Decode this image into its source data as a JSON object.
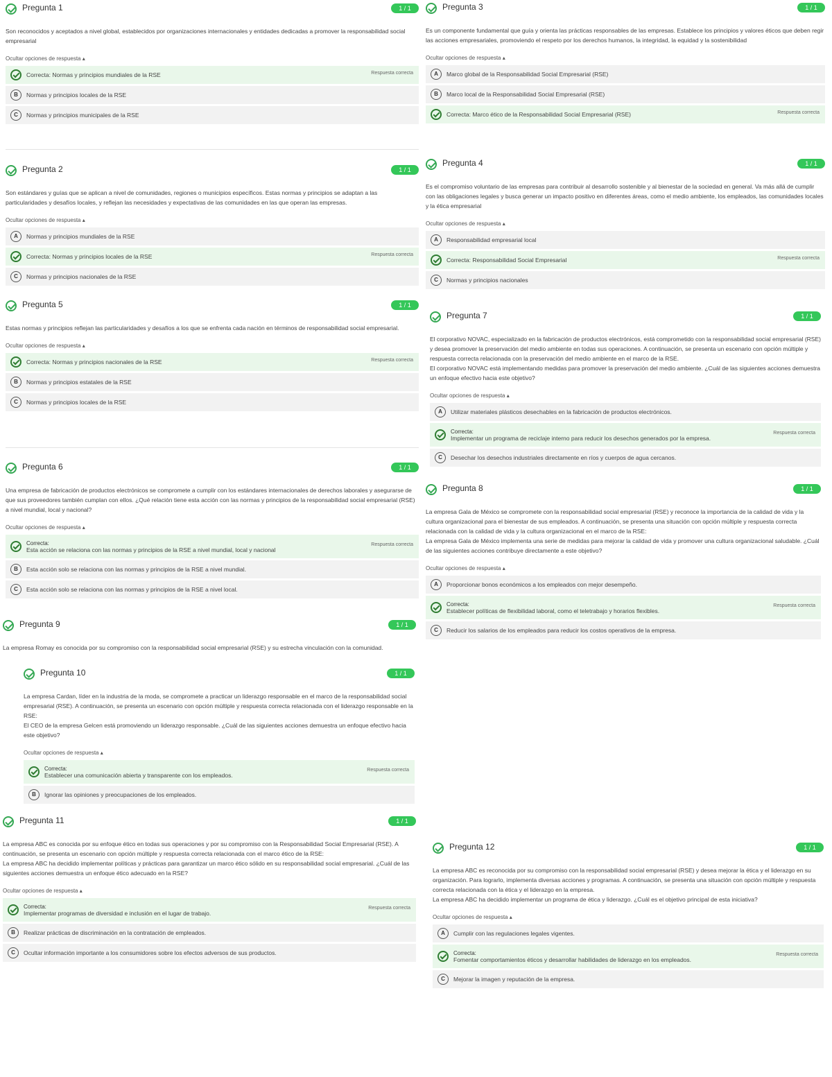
{
  "colors": {
    "accent": "#34c759",
    "correct_bg": "#e9f7ea",
    "option_bg": "#f2f2f2"
  },
  "ui": {
    "hide_options": "Ocultar opciones de respuesta ▴",
    "correct_prefix": "Correcta:",
    "correct_response": "Respuesta correcta",
    "icon_check": "check-circle-icon"
  },
  "questions": {
    "q1": {
      "title": "Pregunta 1",
      "score": "1 / 1",
      "text": "Son reconocidos y aceptados a nivel global, establecidos por organizaciones internacionales y entidades dedicadas a promover la responsabilidad social empresarial",
      "opts": [
        {
          "letter": "A",
          "text": "Correcta: Normas y principios mundiales de la RSE",
          "correct": true
        },
        {
          "letter": "B",
          "text": "Normas y principios locales de la RSE"
        },
        {
          "letter": "C",
          "text": "Normas y principios municipales de la RSE"
        }
      ]
    },
    "q2": {
      "title": "Pregunta 2",
      "score": "1 / 1",
      "text": "Son estándares y guías que se aplican a nivel de comunidades, regiones o municipios específicos. Estas normas y principios se adaptan a las particularidades y desafíos locales, y reflejan las necesidades y expectativas de las comunidades en las que operan las empresas.",
      "opts": [
        {
          "letter": "A",
          "text": "Normas y principios mundiales de la RSE"
        },
        {
          "letter": "B",
          "text": "Correcta: Normas y principios locales de la RSE",
          "correct": true
        },
        {
          "letter": "C",
          "text": "Normas y principios nacionales de la RSE"
        }
      ]
    },
    "q3": {
      "title": "Pregunta 3",
      "score": "1 / 1",
      "text": "Es un componente fundamental que guía y orienta las prácticas responsables de las empresas. Establece los principios y valores éticos que deben regir las acciones empresariales, promoviendo el respeto por los derechos humanos, la integridad, la equidad y la sostenibilidad",
      "opts": [
        {
          "letter": "A",
          "text": "Marco global de la Responsabilidad Social Empresarial (RSE)"
        },
        {
          "letter": "B",
          "text": "Marco local de la Responsabilidad Social Empresarial (RSE)"
        },
        {
          "letter": "C",
          "text": "Correcta: Marco ético de la Responsabilidad Social Empresarial (RSE)",
          "correct": true
        }
      ]
    },
    "q4": {
      "title": "Pregunta 4",
      "score": "1 / 1",
      "text": "Es el compromiso voluntario de las empresas para contribuir al desarrollo sostenible y al bienestar de la sociedad en general. Va más allá de cumplir con las obligaciones legales y busca generar un impacto positivo en diferentes áreas, como el medio ambiente, los empleados, las comunidades locales y la ética empresarial",
      "opts": [
        {
          "letter": "A",
          "text": "Responsabilidad empresarial local"
        },
        {
          "letter": "B",
          "text": "Correcta: Responsabilidad Social Empresarial",
          "correct": true
        },
        {
          "letter": "C",
          "text": "Normas y principios nacionales"
        }
      ]
    },
    "q5": {
      "title": "Pregunta 5",
      "score": "1 / 1",
      "text": "Estas normas y principios reflejan las particularidades y desafíos a los que se enfrenta cada nación en términos de responsabilidad social empresarial.",
      "opts": [
        {
          "letter": "A",
          "text": "Correcta: Normas y principios nacionales de la RSE",
          "correct": true
        },
        {
          "letter": "B",
          "text": "Normas y principios estatales de la RSE"
        },
        {
          "letter": "C",
          "text": "Normas y principios locales de la RSE"
        }
      ]
    },
    "q6": {
      "title": "Pregunta 6",
      "score": "1 / 1",
      "text": "Una empresa de fabricación de productos electrónicos se compromete a cumplir con los estándares internacionales de derechos laborales y asegurarse de que sus proveedores también cumplan con ellos. ¿Qué relación tiene esta acción con las normas y principios de la responsabilidad social empresarial (RSE) a nivel mundial, local y nacional?",
      "opts": [
        {
          "letter": "A",
          "text": "Esta acción se relaciona con las normas y principios de la RSE a nivel mundial, local y nacional",
          "correct": true
        },
        {
          "letter": "B",
          "text": "Esta acción solo se relaciona con las normas y principios de la RSE a nivel mundial."
        },
        {
          "letter": "C",
          "text": "Esta acción solo se relaciona con las normas y principios de la RSE a nivel local."
        }
      ]
    },
    "q7": {
      "title": "Pregunta 7",
      "score": "1 / 1",
      "text": "El corporativo NOVAC, especializado en la fabricación de productos electrónicos, está comprometido con la responsabilidad social empresarial (RSE) y desea promover la preservación del medio ambiente en todas sus operaciones. A continuación, se presenta un escenario con opción múltiple y respuesta correcta relacionada con la preservación del medio ambiente en el marco de la RSE.\nEl corporativo NOVAC está implementando medidas para promover la preservación del medio ambiente. ¿Cuál de las siguientes acciones demuestra un enfoque efectivo hacia este objetivo?",
      "opts": [
        {
          "letter": "A",
          "text": "Utilizar materiales plásticos desechables en la fabricación de productos electrónicos."
        },
        {
          "letter": "B",
          "text": "Implementar un programa de reciclaje interno para reducir los desechos generados por la empresa.",
          "correct": true
        },
        {
          "letter": "C",
          "text": "Desechar los desechos industriales directamente en ríos y cuerpos de agua cercanos."
        }
      ]
    },
    "q8": {
      "title": "Pregunta 8",
      "score": "1 / 1",
      "text": "La empresa Gala de México se compromete con la responsabilidad social empresarial (RSE) y reconoce la importancia de la calidad de vida y la cultura organizacional para el bienestar de sus empleados. A continuación, se presenta una situación con opción múltiple y respuesta correcta relacionada con la calidad de vida y la cultura organizacional en el marco de la RSE:\nLa empresa Gala de México implementa una serie de medidas para mejorar la calidad de vida y promover una cultura organizacional saludable. ¿Cuál de las siguientes acciones contribuye directamente a este objetivo?",
      "opts": [
        {
          "letter": "A",
          "text": "Proporcionar bonos económicos a los empleados con mejor desempeño."
        },
        {
          "letter": "B",
          "text": "Establecer políticas de flexibilidad laboral, como el teletrabajo y horarios flexibles.",
          "correct": true
        },
        {
          "letter": "C",
          "text": "Reducir los salarios de los empleados para reducir los costos operativos de la empresa."
        }
      ]
    },
    "q9": {
      "title": "Pregunta 9",
      "score": "1 / 1",
      "text": "La empresa Romay es conocida por su compromiso con la responsabilidad social empresarial (RSE) y su estrecha vinculación con la comunidad."
    },
    "q10": {
      "title": "Pregunta 10",
      "score": "1 / 1",
      "text": "La empresa Cardan, líder en la industria de la moda, se compromete a practicar un liderazgo responsable en el marco de la responsabilidad social empresarial (RSE). A continuación, se presenta un escenario con opción múltiple y respuesta correcta relacionada con el liderazgo responsable en la RSE:\nEl CEO de la empresa Gelcen está promoviendo un liderazgo responsable. ¿Cuál de las siguientes acciones demuestra un enfoque efectivo hacia este objetivo?",
      "opts": [
        {
          "letter": "A",
          "text": "Establecer una comunicación abierta y transparente con los empleados.",
          "correct": true
        },
        {
          "letter": "B",
          "text": "Ignorar las opiniones y preocupaciones de los empleados."
        }
      ]
    },
    "q11": {
      "title": "Pregunta 11",
      "score": "1 / 1",
      "text": "La empresa ABC es conocida por su enfoque ético en todas sus operaciones y por su compromiso con la Responsabilidad Social Empresarial (RSE). A continuación, se presenta un escenario con opción múltiple y respuesta correcta relacionada con el marco ético de la RSE:\nLa empresa ABC ha decidido implementar políticas y prácticas para garantizar un marco ético sólido en su responsabilidad social empresarial. ¿Cuál de las siguientes acciones demuestra un enfoque ético adecuado en la RSE?",
      "opts": [
        {
          "letter": "A",
          "text": "Implementar programas de diversidad e inclusión en el lugar de trabajo.",
          "correct": true
        },
        {
          "letter": "B",
          "text": "Realizar prácticas de discriminación en la contratación de empleados."
        },
        {
          "letter": "C",
          "text": "Ocultar información importante a los consumidores sobre los efectos adversos de sus productos."
        }
      ]
    },
    "q12": {
      "title": "Pregunta 12",
      "score": "1 / 1",
      "text": "La empresa ABC es reconocida por su compromiso con la responsabilidad social empresarial (RSE) y desea mejorar la ética y el liderazgo en su organización. Para lograrlo, implementa diversas acciones y programas. A continuación, se presenta una situación con opción múltiple y respuesta correcta relacionada con la ética y el liderazgo en la empresa.\nLa empresa ABC ha decidido implementar un programa de ética y liderazgo. ¿Cuál es el objetivo principal de esta iniciativa?",
      "opts": [
        {
          "letter": "A",
          "text": "Cumplir con las regulaciones legales vigentes."
        },
        {
          "letter": "B",
          "text": "Fomentar comportamientos éticos y desarrollar habilidades de liderazgo en los empleados.",
          "correct": true
        },
        {
          "letter": "C",
          "text": "Mejorar la imagen y reputación de la empresa."
        }
      ]
    }
  }
}
